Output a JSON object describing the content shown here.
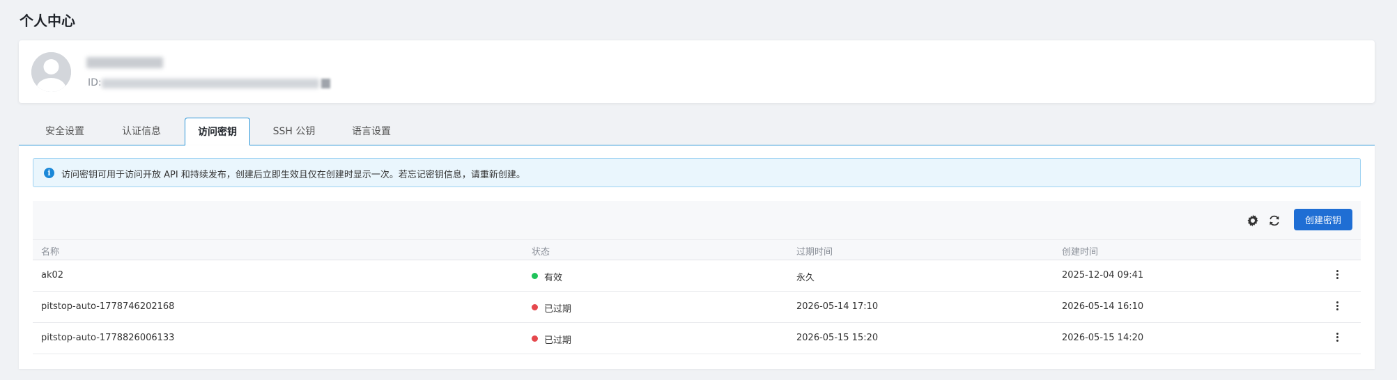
{
  "page": {
    "title": "个人中心"
  },
  "profile": {
    "id_label": "ID:"
  },
  "tabs": [
    {
      "label": "安全设置"
    },
    {
      "label": "认证信息"
    },
    {
      "label": "访问密钥"
    },
    {
      "label": "SSH 公钥"
    },
    {
      "label": "语言设置"
    }
  ],
  "active_tab": "访问密钥",
  "alert": {
    "icon": "info-icon",
    "text": "访问密钥可用于访问开放 API 和持续发布，创建后立即生效且仅在创建时显示一次。若忘记密钥信息，请重新创建。"
  },
  "toolbar": {
    "settings_icon": "gear-icon",
    "refresh_icon": "refresh-icon",
    "create_label": "创建密钥"
  },
  "table": {
    "columns": [
      "名称",
      "状态",
      "过期时间",
      "创建时间"
    ],
    "rows": [
      {
        "name": "ak02",
        "status": "有效",
        "status_color": "#1fc35a",
        "expires": "永久",
        "created": "2025-12-04 09:41"
      },
      {
        "name": "pitstop-auto-1778746202168",
        "status": "已过期",
        "status_color": "#e5484d",
        "expires": "2026-05-14 17:10",
        "created": "2026-05-14 16:10"
      },
      {
        "name": "pitstop-auto-1778826006133",
        "status": "已过期",
        "status_color": "#e5484d",
        "expires": "2026-05-15 15:20",
        "created": "2026-05-15 14:20"
      }
    ]
  },
  "colors": {
    "primary": "#1f6ed4",
    "tab_border": "#2a95d8",
    "info": "#1b88d8",
    "background": "#f0f2f5"
  }
}
